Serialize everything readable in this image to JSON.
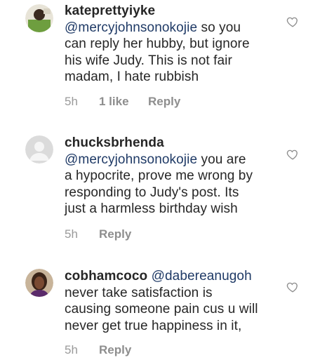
{
  "comments": [
    {
      "username": "kateprettyiyke",
      "mention": "@mercyjohnsonokojie",
      "line1_rest": " so you",
      "lines": [
        "can reply her hubby, but ignore",
        "his wife Judy. This is not fair",
        "madam, I hate rubbish"
      ],
      "time": "5h",
      "likes": "1 like",
      "reply": "Reply",
      "avatar_color": "#5c8f3a",
      "heart_icon": "heart-outline-icon"
    },
    {
      "username": "chucksbrhenda",
      "mention": "@mercyjohnsonokojie",
      "line1_rest": " you are",
      "lines": [
        "a hypocrite, prove me wrong by",
        "responding to Judy's post. Its",
        "just a harmless birthday wish"
      ],
      "time": "5h",
      "reply": "Reply",
      "avatar_color": "#d9d9d9",
      "heart_icon": "heart-outline-icon"
    },
    {
      "username": "cobhamcoco",
      "mention": "@dabereanugoh",
      "lines": [
        "never take satisfaction is",
        "causing someone pain cus u will",
        "never get true happiness in it,"
      ],
      "time": "5h",
      "reply": "Reply",
      "avatar_color": "#6b3b2a",
      "heart_icon": "heart-outline-icon"
    }
  ]
}
